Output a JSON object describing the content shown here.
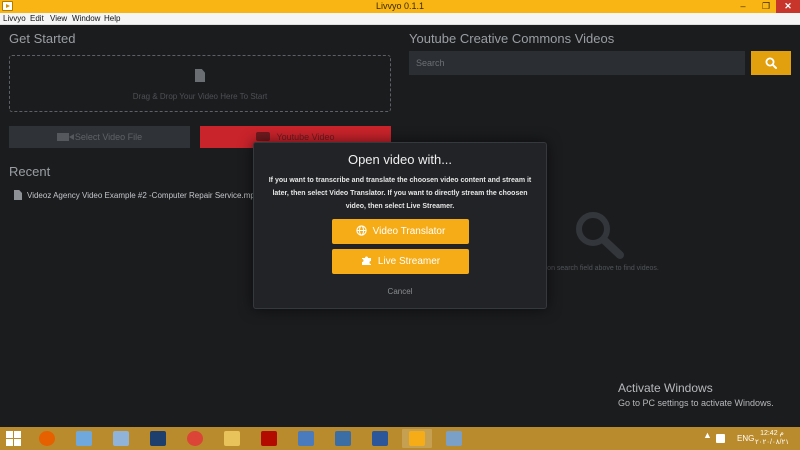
{
  "window": {
    "title": "Livvyo 0.1.1",
    "minimize": "–",
    "maximize": "❐",
    "close": "✕"
  },
  "menu": [
    "Livvyo",
    "Edit",
    "View",
    "Window",
    "Help"
  ],
  "left": {
    "get_started_title": "Get Started",
    "drop_text": "Drag & Drop Your Video Here To Start",
    "select_file_label": "Select Video File",
    "youtube_label": "Youtube Video",
    "recent_title": "Recent",
    "recent_items": [
      "Videoz Agency Video Example #2 -Computer Repair Service.mp4"
    ]
  },
  "right": {
    "title": "Youtube Creative Commons Videos",
    "search_placeholder": "Search",
    "hint": "ping on search field above to find videos."
  },
  "modal": {
    "title": "Open video with...",
    "body": "If you want to transcribe and translate the choosen video content and stream it later, then select Video Translator. If you want to directly stream the choosen video, then select Live Streamer.",
    "translator_label": "Video Translator",
    "streamer_label": "Live Streamer",
    "cancel_label": "Cancel"
  },
  "watermark": {
    "line1": "Activate Windows",
    "line2": "Go to PC settings to activate Windows."
  },
  "taskbar": {
    "apps": [
      {
        "name": "firefox-icon",
        "color": "#e66000"
      },
      {
        "name": "explorer-window-icon",
        "color": "#6fa8dc"
      },
      {
        "name": "calculator-icon",
        "color": "#8fb3d9"
      },
      {
        "name": "photoshop-icon",
        "color": "#1c3f6e"
      },
      {
        "name": "chrome-icon",
        "color": "#db4437"
      },
      {
        "name": "file-explorer-icon",
        "color": "#e8c25a"
      },
      {
        "name": "acrobat-icon",
        "color": "#b30b00"
      },
      {
        "name": "photos-icon",
        "color": "#4b7bbf"
      },
      {
        "name": "network-icon",
        "color": "#3a6ea5"
      },
      {
        "name": "word-icon",
        "color": "#2b579a"
      },
      {
        "name": "livvyo-icon",
        "color": "#f5ac16"
      },
      {
        "name": "tools-icon",
        "color": "#7aa0c8"
      }
    ],
    "lang": "ENG",
    "time": "12:42 م",
    "date": "٢٠٢٠/٠٨/٢١"
  },
  "colors": {
    "accent": "#f5ac16",
    "youtube_red": "#c9232b",
    "titlebar": "#f8b514"
  }
}
